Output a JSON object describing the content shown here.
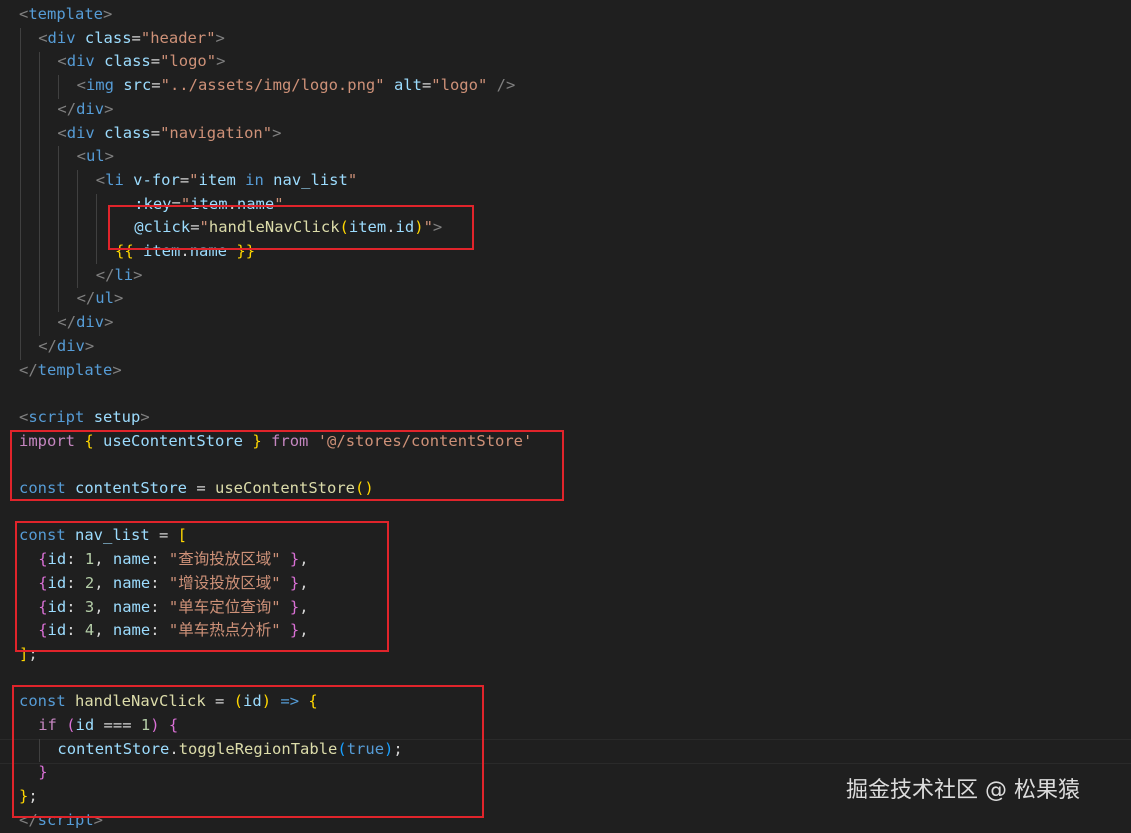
{
  "colors": {
    "background": "#1f1f1f",
    "tag": "#808080",
    "tagname": "#569cd6",
    "attr": "#9cdcfe",
    "string": "#ce9178",
    "keyword": "#569cd6",
    "control": "#c586c0",
    "variable": "#9cdcfe",
    "function": "#dcdcaa",
    "number": "#b5cea8",
    "bracket1": "#ffd700",
    "bracket2": "#da70d6",
    "bracket3": "#179fff",
    "text": "#d4d4d4",
    "highlight_box": "#e0242b"
  },
  "watermark": "掘金技术社区 @ 松果猿",
  "code_lines": [
    {
      "indent": 0,
      "tokens": [
        [
          "<",
          "tag"
        ],
        [
          "template",
          "tagname"
        ],
        [
          ">",
          "tag"
        ]
      ]
    },
    {
      "indent": 1,
      "tokens": [
        [
          "<",
          "tag"
        ],
        [
          "div",
          "tagname"
        ],
        [
          " ",
          "text"
        ],
        [
          "class",
          "attr"
        ],
        [
          "=",
          "text"
        ],
        [
          "\"header\"",
          "string"
        ],
        [
          ">",
          "tag"
        ]
      ]
    },
    {
      "indent": 2,
      "tokens": [
        [
          "<",
          "tag"
        ],
        [
          "div",
          "tagname"
        ],
        [
          " ",
          "text"
        ],
        [
          "class",
          "attr"
        ],
        [
          "=",
          "text"
        ],
        [
          "\"logo\"",
          "string"
        ],
        [
          ">",
          "tag"
        ]
      ]
    },
    {
      "indent": 3,
      "tokens": [
        [
          "<",
          "tag"
        ],
        [
          "img",
          "tagname"
        ],
        [
          " ",
          "text"
        ],
        [
          "src",
          "attr"
        ],
        [
          "=",
          "text"
        ],
        [
          "\"../assets/img/logo.png\"",
          "string"
        ],
        [
          " ",
          "text"
        ],
        [
          "alt",
          "attr"
        ],
        [
          "=",
          "text"
        ],
        [
          "\"logo\"",
          "string"
        ],
        [
          " />",
          "tag"
        ]
      ]
    },
    {
      "indent": 2,
      "tokens": [
        [
          "</",
          "tag"
        ],
        [
          "div",
          "tagname"
        ],
        [
          ">",
          "tag"
        ]
      ]
    },
    {
      "indent": 2,
      "tokens": [
        [
          "<",
          "tag"
        ],
        [
          "div",
          "tagname"
        ],
        [
          " ",
          "text"
        ],
        [
          "class",
          "attr"
        ],
        [
          "=",
          "text"
        ],
        [
          "\"navigation\"",
          "string"
        ],
        [
          ">",
          "tag"
        ]
      ]
    },
    {
      "indent": 3,
      "tokens": [
        [
          "<",
          "tag"
        ],
        [
          "ul",
          "tagname"
        ],
        [
          ">",
          "tag"
        ]
      ]
    },
    {
      "indent": 4,
      "tokens": [
        [
          "<",
          "tag"
        ],
        [
          "li",
          "tagname"
        ],
        [
          " ",
          "text"
        ],
        [
          "v-for",
          "attr"
        ],
        [
          "=",
          "text"
        ],
        [
          "\"",
          "string"
        ],
        [
          "item",
          "variable"
        ],
        [
          " in ",
          "keyword"
        ],
        [
          "nav_list",
          "variable"
        ],
        [
          "\"",
          "string"
        ]
      ]
    },
    {
      "indent": 6,
      "tokens": [
        [
          ":key",
          "attr"
        ],
        [
          "=",
          "text"
        ],
        [
          "\"",
          "string"
        ],
        [
          "item",
          "variable"
        ],
        [
          ".",
          "text"
        ],
        [
          "name",
          "variable"
        ],
        [
          "\"",
          "string"
        ]
      ]
    },
    {
      "indent": 6,
      "tokens": [
        [
          "@click",
          "attr"
        ],
        [
          "=",
          "text"
        ],
        [
          "\"",
          "string"
        ],
        [
          "handleNavClick",
          "function"
        ],
        [
          "(",
          "bracket1"
        ],
        [
          "item",
          "variable"
        ],
        [
          ".",
          "text"
        ],
        [
          "id",
          "variable"
        ],
        [
          ")",
          "bracket1"
        ],
        [
          "\"",
          "string"
        ],
        [
          ">",
          "tag"
        ]
      ]
    },
    {
      "indent": 5,
      "tokens": [
        [
          "{{",
          "bracket1"
        ],
        [
          " ",
          "text"
        ],
        [
          "item",
          "variable"
        ],
        [
          ".",
          "text"
        ],
        [
          "name",
          "variable"
        ],
        [
          " ",
          "text"
        ],
        [
          "}}",
          "bracket1"
        ]
      ]
    },
    {
      "indent": 4,
      "tokens": [
        [
          "</",
          "tag"
        ],
        [
          "li",
          "tagname"
        ],
        [
          ">",
          "tag"
        ]
      ]
    },
    {
      "indent": 3,
      "tokens": [
        [
          "</",
          "tag"
        ],
        [
          "ul",
          "tagname"
        ],
        [
          ">",
          "tag"
        ]
      ]
    },
    {
      "indent": 2,
      "tokens": [
        [
          "</",
          "tag"
        ],
        [
          "div",
          "tagname"
        ],
        [
          ">",
          "tag"
        ]
      ]
    },
    {
      "indent": 1,
      "tokens": [
        [
          "</",
          "tag"
        ],
        [
          "div",
          "tagname"
        ],
        [
          ">",
          "tag"
        ]
      ]
    },
    {
      "indent": 0,
      "tokens": [
        [
          "</",
          "tag"
        ],
        [
          "template",
          "tagname"
        ],
        [
          ">",
          "tag"
        ]
      ]
    },
    {
      "indent": 0,
      "tokens": []
    },
    {
      "indent": 0,
      "tokens": [
        [
          "<",
          "tag"
        ],
        [
          "script",
          "tagname"
        ],
        [
          " ",
          "text"
        ],
        [
          "setup",
          "attr"
        ],
        [
          ">",
          "tag"
        ]
      ]
    },
    {
      "indent": 0,
      "tokens": [
        [
          "import",
          "control"
        ],
        [
          " ",
          "text"
        ],
        [
          "{",
          "bracket1"
        ],
        [
          " ",
          "text"
        ],
        [
          "useContentStore",
          "variable"
        ],
        [
          " ",
          "text"
        ],
        [
          "}",
          "bracket1"
        ],
        [
          " ",
          "text"
        ],
        [
          "from",
          "control"
        ],
        [
          " ",
          "text"
        ],
        [
          "'@/stores/contentStore'",
          "string"
        ]
      ]
    },
    {
      "indent": 0,
      "tokens": []
    },
    {
      "indent": 0,
      "tokens": [
        [
          "const",
          "keyword"
        ],
        [
          " ",
          "text"
        ],
        [
          "contentStore",
          "variable"
        ],
        [
          " = ",
          "text"
        ],
        [
          "useContentStore",
          "function"
        ],
        [
          "()",
          "bracket1"
        ]
      ]
    },
    {
      "indent": 0,
      "tokens": []
    },
    {
      "indent": 0,
      "tokens": [
        [
          "const",
          "keyword"
        ],
        [
          " ",
          "text"
        ],
        [
          "nav_list",
          "variable"
        ],
        [
          " = ",
          "text"
        ],
        [
          "[",
          "bracket1"
        ]
      ]
    },
    {
      "indent": 1,
      "tokens": [
        [
          "{",
          "bracket2"
        ],
        [
          "id",
          "variable"
        ],
        [
          ": ",
          "text"
        ],
        [
          "1",
          "number"
        ],
        [
          ", ",
          "text"
        ],
        [
          "name",
          "variable"
        ],
        [
          ": ",
          "text"
        ],
        [
          "\"查询投放区域\"",
          "string"
        ],
        [
          " ",
          "text"
        ],
        [
          "}",
          "bracket2"
        ],
        [
          ",",
          "text"
        ]
      ]
    },
    {
      "indent": 1,
      "tokens": [
        [
          "{",
          "bracket2"
        ],
        [
          "id",
          "variable"
        ],
        [
          ": ",
          "text"
        ],
        [
          "2",
          "number"
        ],
        [
          ", ",
          "text"
        ],
        [
          "name",
          "variable"
        ],
        [
          ": ",
          "text"
        ],
        [
          "\"增设投放区域\"",
          "string"
        ],
        [
          " ",
          "text"
        ],
        [
          "}",
          "bracket2"
        ],
        [
          ",",
          "text"
        ]
      ]
    },
    {
      "indent": 1,
      "tokens": [
        [
          "{",
          "bracket2"
        ],
        [
          "id",
          "variable"
        ],
        [
          ": ",
          "text"
        ],
        [
          "3",
          "number"
        ],
        [
          ", ",
          "text"
        ],
        [
          "name",
          "variable"
        ],
        [
          ": ",
          "text"
        ],
        [
          "\"单车定位查询\"",
          "string"
        ],
        [
          " ",
          "text"
        ],
        [
          "}",
          "bracket2"
        ],
        [
          ",",
          "text"
        ]
      ]
    },
    {
      "indent": 1,
      "tokens": [
        [
          "{",
          "bracket2"
        ],
        [
          "id",
          "variable"
        ],
        [
          ": ",
          "text"
        ],
        [
          "4",
          "number"
        ],
        [
          ", ",
          "text"
        ],
        [
          "name",
          "variable"
        ],
        [
          ": ",
          "text"
        ],
        [
          "\"单车热点分析\"",
          "string"
        ],
        [
          " ",
          "text"
        ],
        [
          "}",
          "bracket2"
        ],
        [
          ",",
          "text"
        ]
      ]
    },
    {
      "indent": 0,
      "tokens": [
        [
          "]",
          "bracket1"
        ],
        [
          ";",
          "text"
        ]
      ]
    },
    {
      "indent": 0,
      "tokens": []
    },
    {
      "indent": 0,
      "tokens": [
        [
          "const",
          "keyword"
        ],
        [
          " ",
          "text"
        ],
        [
          "handleNavClick",
          "function"
        ],
        [
          " = ",
          "text"
        ],
        [
          "(",
          "bracket1"
        ],
        [
          "id",
          "variable"
        ],
        [
          ")",
          "bracket1"
        ],
        [
          " ",
          "text"
        ],
        [
          "=>",
          "keyword"
        ],
        [
          " ",
          "text"
        ],
        [
          "{",
          "bracket1"
        ]
      ]
    },
    {
      "indent": 1,
      "tokens": [
        [
          "if",
          "control"
        ],
        [
          " ",
          "text"
        ],
        [
          "(",
          "bracket2"
        ],
        [
          "id",
          "variable"
        ],
        [
          " === ",
          "text"
        ],
        [
          "1",
          "number"
        ],
        [
          ")",
          "bracket2"
        ],
        [
          " ",
          "text"
        ],
        [
          "{",
          "bracket2"
        ]
      ]
    },
    {
      "indent": 2,
      "tokens": [
        [
          "contentStore",
          "variable"
        ],
        [
          ".",
          "text"
        ],
        [
          "toggleRegionTable",
          "function"
        ],
        [
          "(",
          "bracket3"
        ],
        [
          "true",
          "keyword"
        ],
        [
          ")",
          "bracket3"
        ],
        [
          ";",
          "text"
        ]
      ]
    },
    {
      "indent": 1,
      "tokens": [
        [
          "}",
          "bracket2"
        ]
      ]
    },
    {
      "indent": 0,
      "tokens": [
        [
          "}",
          "bracket1"
        ],
        [
          ";",
          "text"
        ]
      ]
    },
    {
      "indent": 0,
      "tokens": [
        [
          "</",
          "tag"
        ],
        [
          "script",
          "tagname"
        ],
        [
          ">",
          "tag"
        ]
      ]
    }
  ]
}
